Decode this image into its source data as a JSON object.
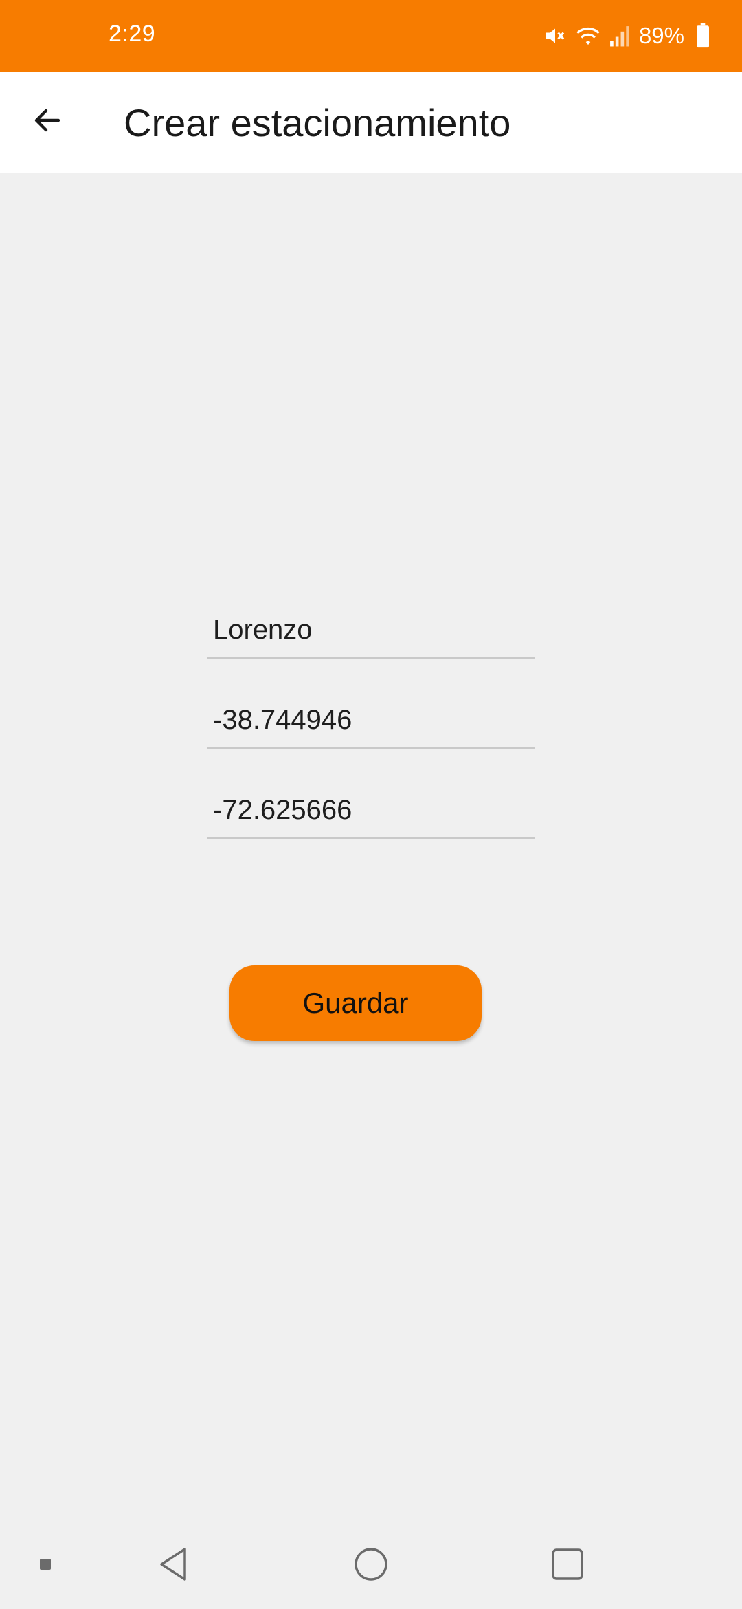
{
  "status_bar": {
    "time": "2:29",
    "battery_percent": "89%",
    "icons": [
      "mute-icon",
      "wifi-icon",
      "signal-icon",
      "battery-icon"
    ],
    "background_color": "#f77c00"
  },
  "app_bar": {
    "back_icon": "arrow-left-icon",
    "title": "Crear estacionamiento"
  },
  "form": {
    "name_value": "Lorenzo",
    "latitude_value": "-38.744946",
    "longitude_value": "-72.625666",
    "save_label": "Guardar",
    "accent_color": "#f77c00"
  },
  "nav_bar": {
    "icons": [
      "dot-icon",
      "back-triangle-icon",
      "home-circle-icon",
      "recents-square-icon"
    ]
  }
}
